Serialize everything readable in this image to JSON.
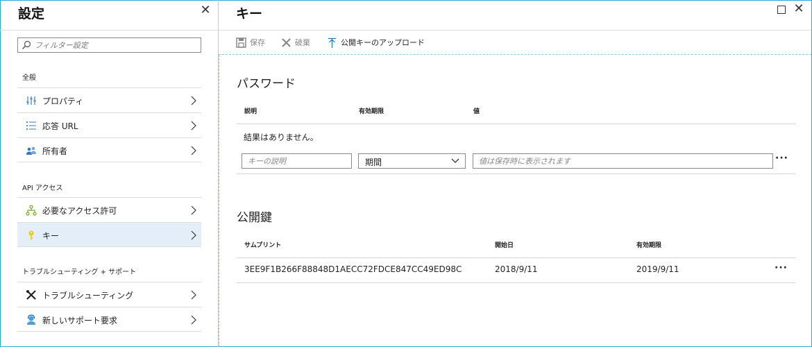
{
  "left_blade": {
    "title": "設定",
    "filter_placeholder": "フィルター設定",
    "sections": [
      {
        "label": "全般",
        "items": [
          {
            "label": "プロパティ",
            "icon": "properties-icon"
          },
          {
            "label": "応答 URL",
            "icon": "list-icon"
          },
          {
            "label": "所有者",
            "icon": "owners-icon"
          }
        ]
      },
      {
        "label": "API アクセス",
        "items": [
          {
            "label": "必要なアクセス許可",
            "icon": "permissions-icon"
          },
          {
            "label": "キー",
            "icon": "key-icon",
            "selected": true
          }
        ]
      },
      {
        "label": "トラブルシューティング + サポート",
        "items": [
          {
            "label": "トラブルシューティング",
            "icon": "tools-icon"
          },
          {
            "label": "新しいサポート要求",
            "icon": "support-icon"
          }
        ]
      }
    ]
  },
  "right_blade": {
    "title": "キー",
    "toolbar": {
      "save_label": "保存",
      "discard_label": "破棄",
      "upload_label": "公開キーのアップロード"
    },
    "passwords": {
      "heading": "パスワード",
      "columns": [
        "説明",
        "有効期限",
        "値"
      ],
      "empty_text": "結果はありません。",
      "description_placeholder": "キーの説明",
      "duration_value": "期間",
      "value_placeholder": "値は保存時に表示されます"
    },
    "public_keys": {
      "heading": "公開鍵",
      "columns": [
        "サムプリント",
        "開始日",
        "有効期限"
      ],
      "rows": [
        {
          "thumbprint": "3EE9F1B266F88848D1AECC72FDCE847CC49ED98C",
          "start": "2018/9/11",
          "expires": "2019/9/11"
        }
      ]
    },
    "more_label": "···"
  },
  "colors": {
    "frame_border": "#2aa7d8",
    "selected_bg": "#e3eef9",
    "accent_blue": "#1a73c9"
  }
}
